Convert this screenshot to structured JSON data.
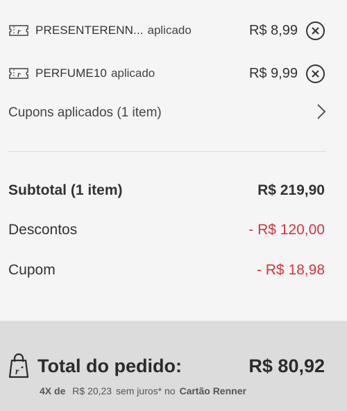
{
  "coupons": [
    {
      "code": "PRESENTERENN...",
      "status": "aplicado",
      "value": "R$ 8,99"
    },
    {
      "code": "PERFUME10",
      "status": "aplicado",
      "value": "R$ 9,99"
    }
  ],
  "applied_link": {
    "label": "Cupons aplicados (1 item)"
  },
  "summary": {
    "subtotal_label": "Subtotal (1 item)",
    "subtotal_value": "R$ 219,90",
    "discounts_label": "Descontos",
    "discounts_value": "- R$ 120,00",
    "coupon_label": "Cupom",
    "coupon_value": "- R$ 18,98"
  },
  "total": {
    "label": "Total do pedido:",
    "value": "R$ 80,92",
    "installments_count": "4X de",
    "installments_amount": "R$ 20,23",
    "installments_terms": "sem juros* no",
    "installments_card": "Cartão Renner"
  },
  "icons": {
    "coupon": "coupon-ticket-icon",
    "remove": "close-circle-icon",
    "chevron": "chevron-right-icon",
    "bag": "shopping-bag-icon"
  },
  "colors": {
    "discount": "#d7333f",
    "background": "#f5f5f5",
    "total_panel": "#dcdcdc"
  }
}
